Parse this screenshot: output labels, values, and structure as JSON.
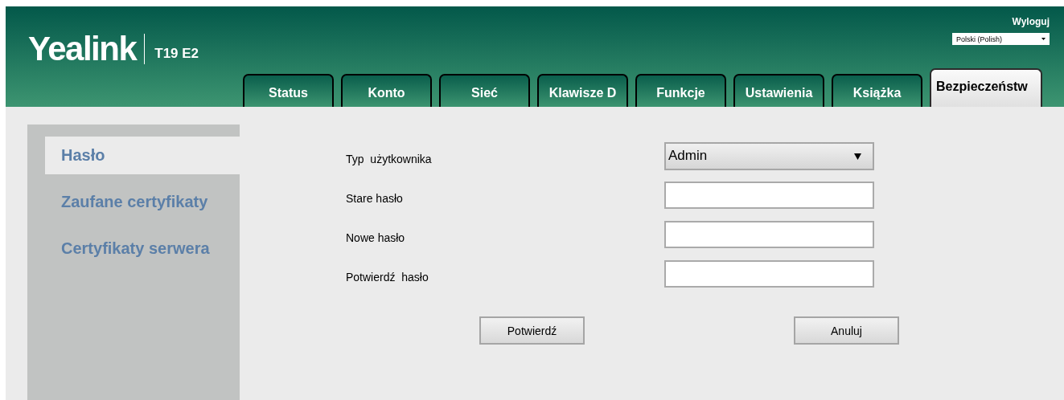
{
  "header": {
    "logo": "Yealink",
    "model": "T19 E2",
    "logout": "Wyloguj",
    "language": {
      "value": "Polski (Polish)"
    }
  },
  "tabs": [
    {
      "label": "Status",
      "selected": false
    },
    {
      "label": "Konto",
      "selected": false
    },
    {
      "label": "Sieć",
      "selected": false
    },
    {
      "label": "Klawisze D",
      "selected": false
    },
    {
      "label": "Funkcje",
      "selected": false
    },
    {
      "label": "Ustawienia",
      "selected": false
    },
    {
      "label": "Książka",
      "selected": false
    },
    {
      "label": "Bezpieczeństw",
      "selected": true
    }
  ],
  "sidebar": {
    "items": [
      {
        "label": "Hasło",
        "selected": true
      },
      {
        "label": "Zaufane certyfikaty",
        "selected": false
      },
      {
        "label": "Certyfikaty serwera",
        "selected": false
      }
    ]
  },
  "form": {
    "fields": [
      {
        "kind": "select",
        "label": "Typ  użytkownika",
        "value": "Admin"
      },
      {
        "kind": "password",
        "label": "Stare hasło"
      },
      {
        "kind": "password",
        "label": "Nowe hasło"
      },
      {
        "kind": "password",
        "label": "Potwierdź  hasło"
      }
    ],
    "buttons": [
      "Potwierdź",
      "Anuluj"
    ]
  }
}
